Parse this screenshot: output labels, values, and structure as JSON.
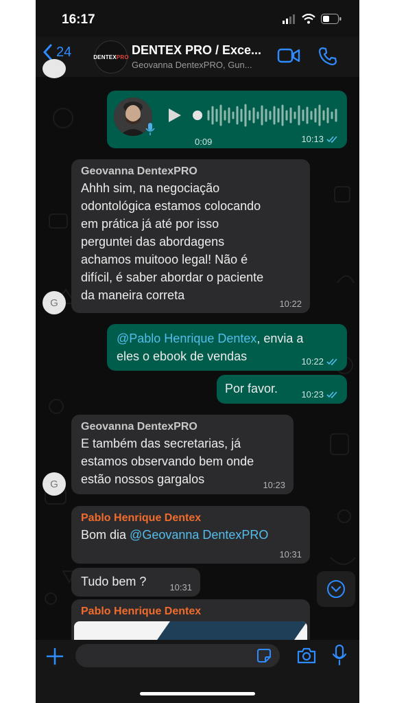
{
  "status": {
    "time": "16:17"
  },
  "header": {
    "back_count": "24",
    "title": "DENTEX PRO / Exce...",
    "subtitle": "Geovanna DentexPRO, Gun...",
    "logo_text_main": "DENTEX",
    "logo_text_accent": "PRO"
  },
  "messages": {
    "voice": {
      "duration": "0:09",
      "time": "10:13"
    },
    "m1": {
      "sender": "Geovanna DentexPRO",
      "lines": [
        "Ahhh sim, na negociação",
        "odontológica estamos colocando",
        "em prática já até por isso",
        "perguntei das abordagens",
        "achamos muitooo legal! Não é",
        "difícil, é saber abordar o paciente",
        "da maneira correta"
      ],
      "time": "10:22",
      "avatar_letter": "G"
    },
    "m2": {
      "mention": "@Pablo Henrique Dentex",
      "text_after": ", envia a",
      "line2": "eles o ebook de vendas",
      "time": "10:22"
    },
    "m3": {
      "text": "Por favor.",
      "time": "10:23"
    },
    "m4": {
      "sender": "Geovanna DentexPRO",
      "lines": [
        "E também das secretarias, já",
        "estamos observando bem onde",
        "estão nossos gargalos"
      ],
      "time": "10:23",
      "avatar_letter": "G"
    },
    "m5": {
      "sender": "Pablo Henrique Dentex",
      "text_before": "Bom dia ",
      "mention": "@Geovanna DentexPRO",
      "time": "10:31"
    },
    "m6": {
      "text": "Tudo bem ?",
      "time": "10:31"
    },
    "m7": {
      "sender": "Pablo Henrique Dentex"
    }
  },
  "colors": {
    "incoming": "#2b2b2d",
    "outgoing": "#005c4b",
    "accent": "#2f8cff",
    "mention": "#53bdeb",
    "sender_orange": "#f06b2c"
  },
  "icons": [
    "chevron-left-icon",
    "video-call-icon",
    "phone-icon",
    "play-icon",
    "mic-icon",
    "double-check-icon",
    "plus-icon",
    "sticker-icon",
    "camera-icon",
    "chevron-down-icon"
  ]
}
